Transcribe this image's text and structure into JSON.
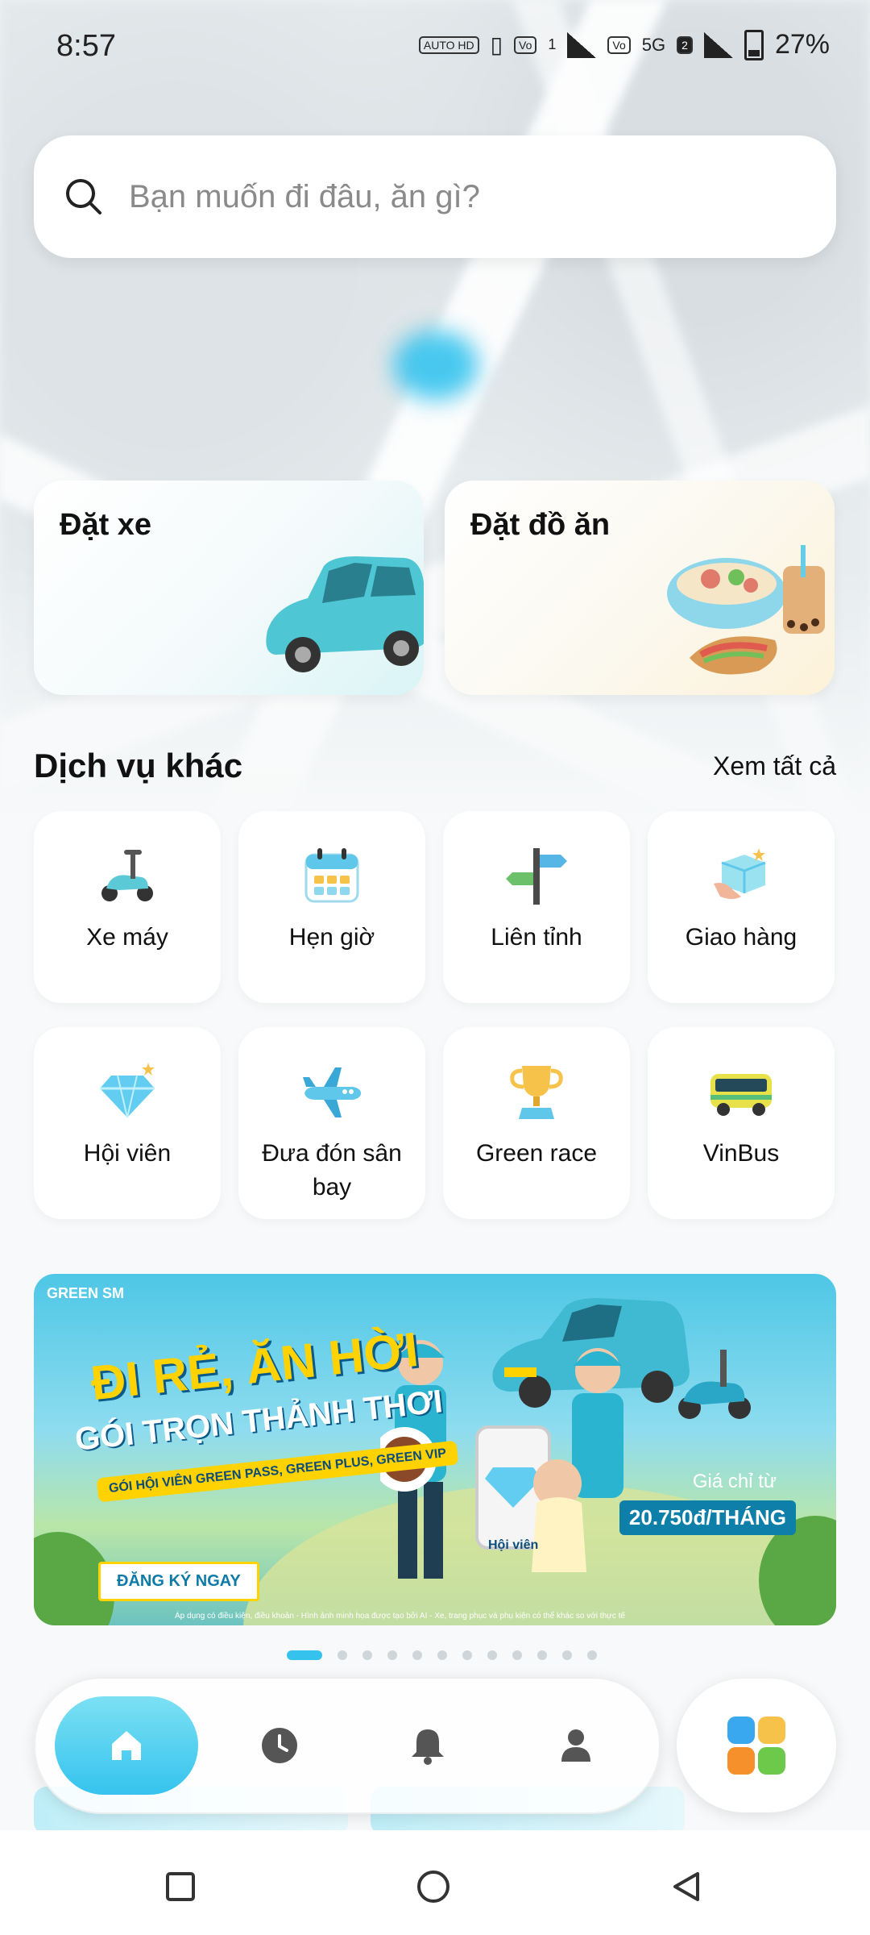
{
  "status_bar": {
    "time": "8:57",
    "auto_hd": "AUTO HD",
    "sim1": "1",
    "network": "5G",
    "sim2": "2",
    "battery": "27%"
  },
  "search": {
    "placeholder": "Bạn muốn đi đâu, ăn gì?"
  },
  "main_services": {
    "ride_label": "Đặt xe",
    "food_label": "Đặt đồ ăn"
  },
  "other_services": {
    "title": "Dịch vụ khác",
    "see_all": "Xem tất cả",
    "items": [
      {
        "label": "Xe máy",
        "icon": "scooter-icon"
      },
      {
        "label": "Hẹn giờ",
        "icon": "calendar-icon"
      },
      {
        "label": "Liên tỉnh",
        "icon": "signpost-icon"
      },
      {
        "label": "Giao hàng",
        "icon": "package-icon"
      },
      {
        "label": "Hội viên",
        "icon": "diamond-icon"
      },
      {
        "label": "Đưa đón sân bay",
        "icon": "airplane-icon"
      },
      {
        "label": "Green race",
        "icon": "trophy-icon"
      },
      {
        "label": "VinBus",
        "icon": "bus-icon"
      }
    ]
  },
  "banner": {
    "brand": "GREEN SM",
    "headline_1": "ĐI RẺ, ĂN HỜI",
    "headline_2": "GÓI TRỌN THẢNH THƠI",
    "subline": "GÓI HỘI VIÊN GREEN PASS, GREEN PLUS, GREEN VIP",
    "cta": "ĐĂNG KÝ NGAY",
    "price_label": "Giá chỉ từ",
    "price_value": "20.750đ/THÁNG",
    "phone_badge": "Hội viên",
    "fine_print": "Áp dụng có điều kiện, điều khoản - Hình ảnh minh họa được tạo bởi AI - Xe, trang phục và phụ kiện có thể khác so với thực tế",
    "carousel_count": 12,
    "carousel_active": 1
  },
  "bottom_nav": {
    "items": [
      {
        "name": "home",
        "icon": "home-icon",
        "active": true
      },
      {
        "name": "history",
        "icon": "clock-icon",
        "active": false
      },
      {
        "name": "notifications",
        "icon": "bell-icon",
        "active": false
      },
      {
        "name": "account",
        "icon": "person-icon",
        "active": false
      }
    ],
    "apps_icon": "apps-grid-icon"
  },
  "colors": {
    "accent": "#35c3ee",
    "banner_yellow": "#ffd200",
    "text": "#111111"
  }
}
